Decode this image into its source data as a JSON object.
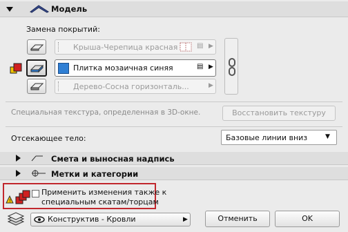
{
  "model_section": {
    "title": "Модель",
    "cover_label": "Замена покрытий:"
  },
  "materials": [
    {
      "name": "Крыша-Черепица красная",
      "swatch": "#a93c2f",
      "dim": true
    },
    {
      "name": "Плитка мозаичная синяя",
      "swatch": "#2f7fd4",
      "dim": false
    },
    {
      "name": "Дерево-Сосна горизонталь...",
      "swatch": "#c8a070",
      "dim": true
    }
  ],
  "texture": {
    "note": "Специальная текстура, определенная в 3D-окне.",
    "restore_button": "Восстановить текстуру"
  },
  "cut_body": {
    "label": "Отсекающее тело:",
    "value": "Базовые линии вниз"
  },
  "collapsed_sections": [
    {
      "title": "Смета и выносная надпись"
    },
    {
      "title": "Метки и категории"
    }
  ],
  "apply_checkbox": {
    "label_line1": "Применить изменения также к",
    "label_line2": "специальным скатам/торцам",
    "checked": false
  },
  "footer": {
    "layer": "Конструктив - Кровли",
    "cancel": "Отменить",
    "ok": "OK"
  },
  "colors": {
    "accent": "#2f7fd4",
    "highlight_frame": "#c1272d",
    "warning": "#f2c200"
  }
}
